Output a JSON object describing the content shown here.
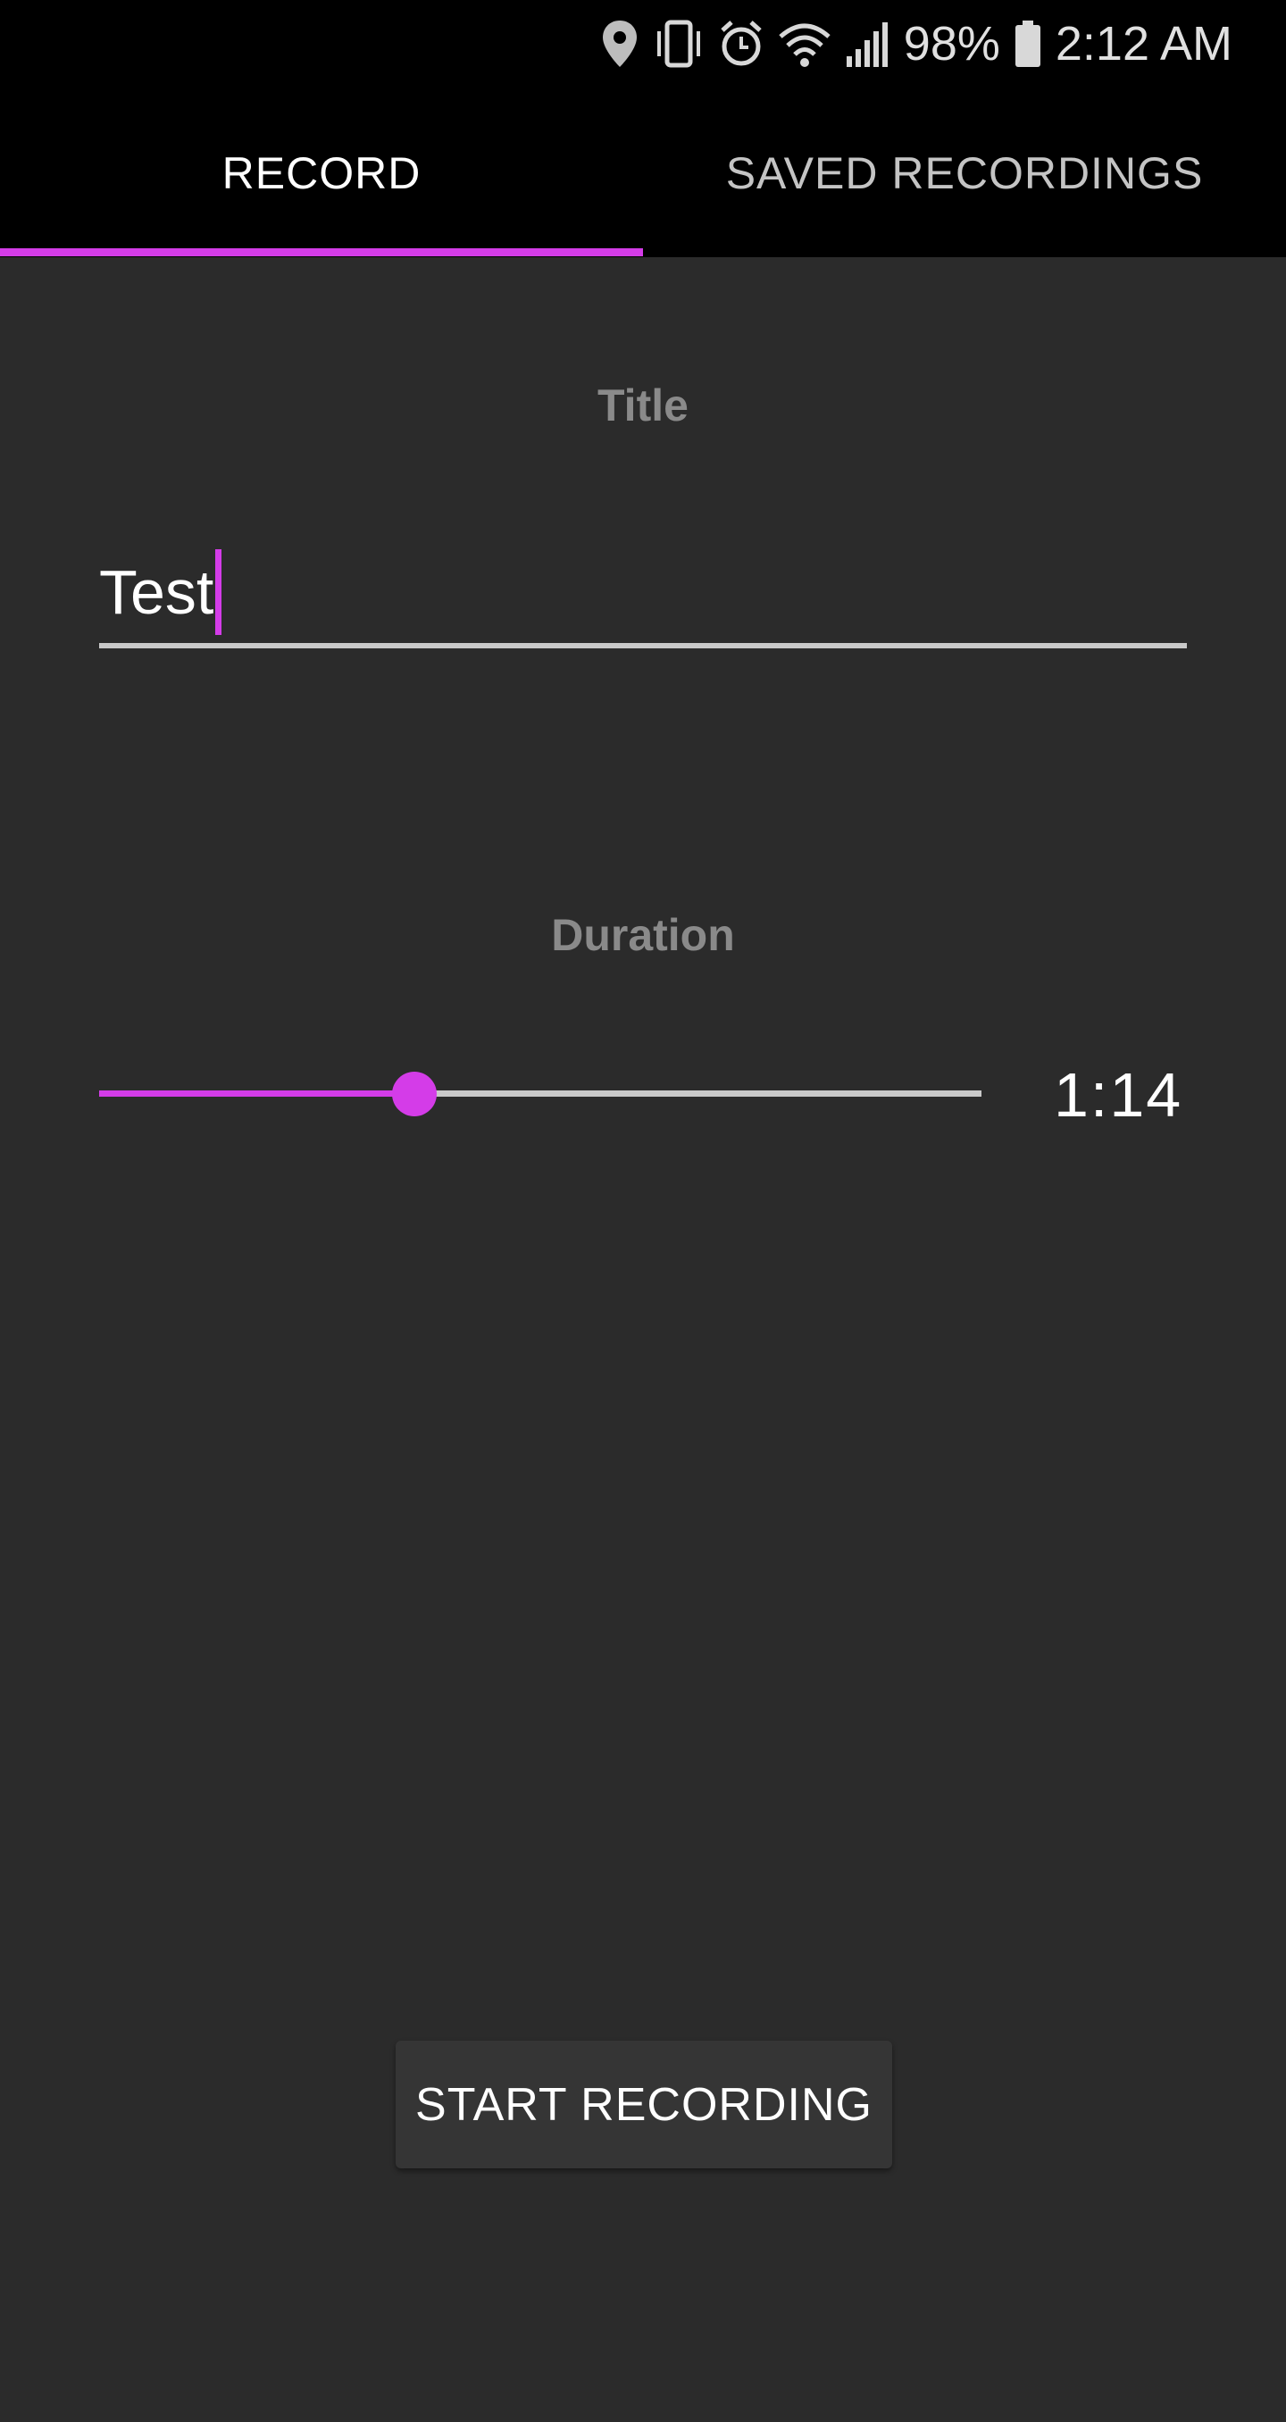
{
  "status_bar": {
    "battery": "98%",
    "time": "2:12 AM",
    "icons": [
      "location-icon",
      "vibrate-icon",
      "alarm-icon",
      "wifi-icon",
      "signal-icon",
      "battery-icon"
    ]
  },
  "tabs": [
    {
      "label": "RECORD",
      "selected": true
    },
    {
      "label": "SAVED RECORDINGS",
      "selected": false
    }
  ],
  "title_section": {
    "label": "Title",
    "value": "Test"
  },
  "duration_section": {
    "label": "Duration",
    "value": "1:14",
    "slider_fraction": 0.357
  },
  "start_button_label": "START RECORDING",
  "colors": {
    "accent": "#d43ce8",
    "background": "#2b2b2b",
    "bar": "#000000",
    "track": "#c9c9c9",
    "label": "#8a8a8a",
    "button": "#353535"
  }
}
